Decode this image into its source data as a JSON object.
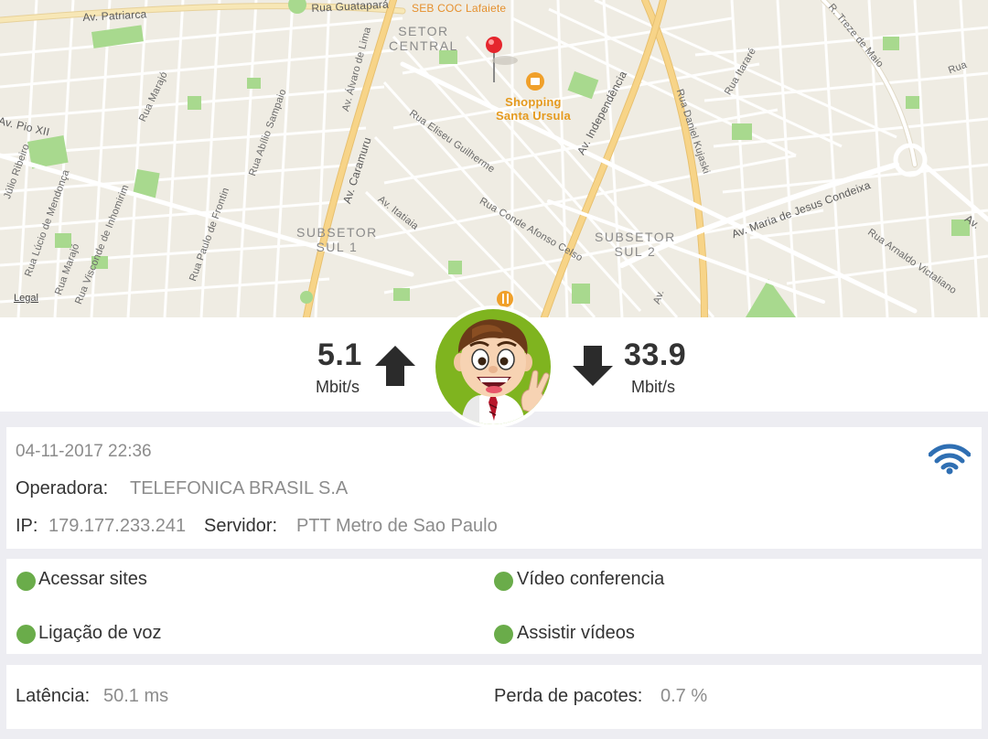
{
  "map": {
    "legal": "Legal",
    "streets": {
      "patriarca": "Av. Patriarca",
      "guatapara": "Rua Guatapará",
      "seb": "SEB COC Lafaiete",
      "treze_maio": "R. Treze de Maio",
      "itarare": "Rua Itararé",
      "marajo_top": "Rua Marajó",
      "lima": "Av. Lima",
      "alvaro": "Av. Álvaro de Lima",
      "abilio": "Rua Abílio Sampaio",
      "pio": "Av. Pio XII",
      "ribeiro": "Júlio Ribeiro",
      "lucio": "Rua Lúcio de Mendonça",
      "visconde": "Rua Visconde de Inhomirim",
      "marajo_bottom": "Rua Marajó",
      "visconde2": "Rua Visconde de Inhomirim",
      "frontin": "Rua Paulo de Frontin",
      "caramuru": "Av. Caramuru",
      "itatiaia": "Av. Itatiaia",
      "eliseu": "Rua Eliseu Guilherme",
      "conde": "Rua Conde Afonso Celso",
      "independencia": "Av. Independência",
      "kujaski": "Rua Daniel Kujaski",
      "jesus": "Av. Maria de Jesus Condeixa",
      "arnaldo": "Rua Arnaldo Victaliano",
      "rua_top_right": "Rua",
      "av_right": "Av.",
      "av_bottom": "Av."
    },
    "areas": {
      "central_1": "SETOR",
      "central_2": "CENTRAL",
      "sul1_1": "SUBSETOR",
      "sul1_2": "SUL 1",
      "sul2_1": "SUBSETOR",
      "sul2_2": "SUL 2"
    },
    "poi": {
      "shopping_1": "Shopping",
      "shopping_2": "Santa Ursula"
    }
  },
  "speed": {
    "upload_value": "5.1",
    "upload_unit": "Mbit/s",
    "download_value": "33.9",
    "download_unit": "Mbit/s"
  },
  "info": {
    "datetime": "04-11-2017 22:36",
    "operator_label": "Operadora:",
    "operator_value": "TELEFONICA BRASIL S.A",
    "ip_label": "IP:",
    "ip_value": "179.177.233.241",
    "server_label": "Servidor:",
    "server_value": "PTT Metro de Sao Paulo",
    "connection_icon": "wifi-icon"
  },
  "quality": {
    "items": [
      {
        "label": "Acessar sites",
        "status_color": "#6aac4a"
      },
      {
        "label": "Vídeo conferencia",
        "status_color": "#6aac4a"
      },
      {
        "label": "Ligação de voz",
        "status_color": "#6aac4a"
      },
      {
        "label": "Assistir vídeos",
        "status_color": "#6aac4a"
      }
    ]
  },
  "stats": {
    "latency_label": "Latência:",
    "latency_value": "50.1 ms",
    "loss_label": "Perda de pacotes:",
    "loss_value": "0.7 %"
  },
  "colors": {
    "map_bg": "#efece3",
    "park": "#a8d98e",
    "major_road": "#f7d488",
    "avatar_bg": "#7fb41f",
    "wifi": "#2f6fb3",
    "status_ok": "#6aac4a"
  }
}
